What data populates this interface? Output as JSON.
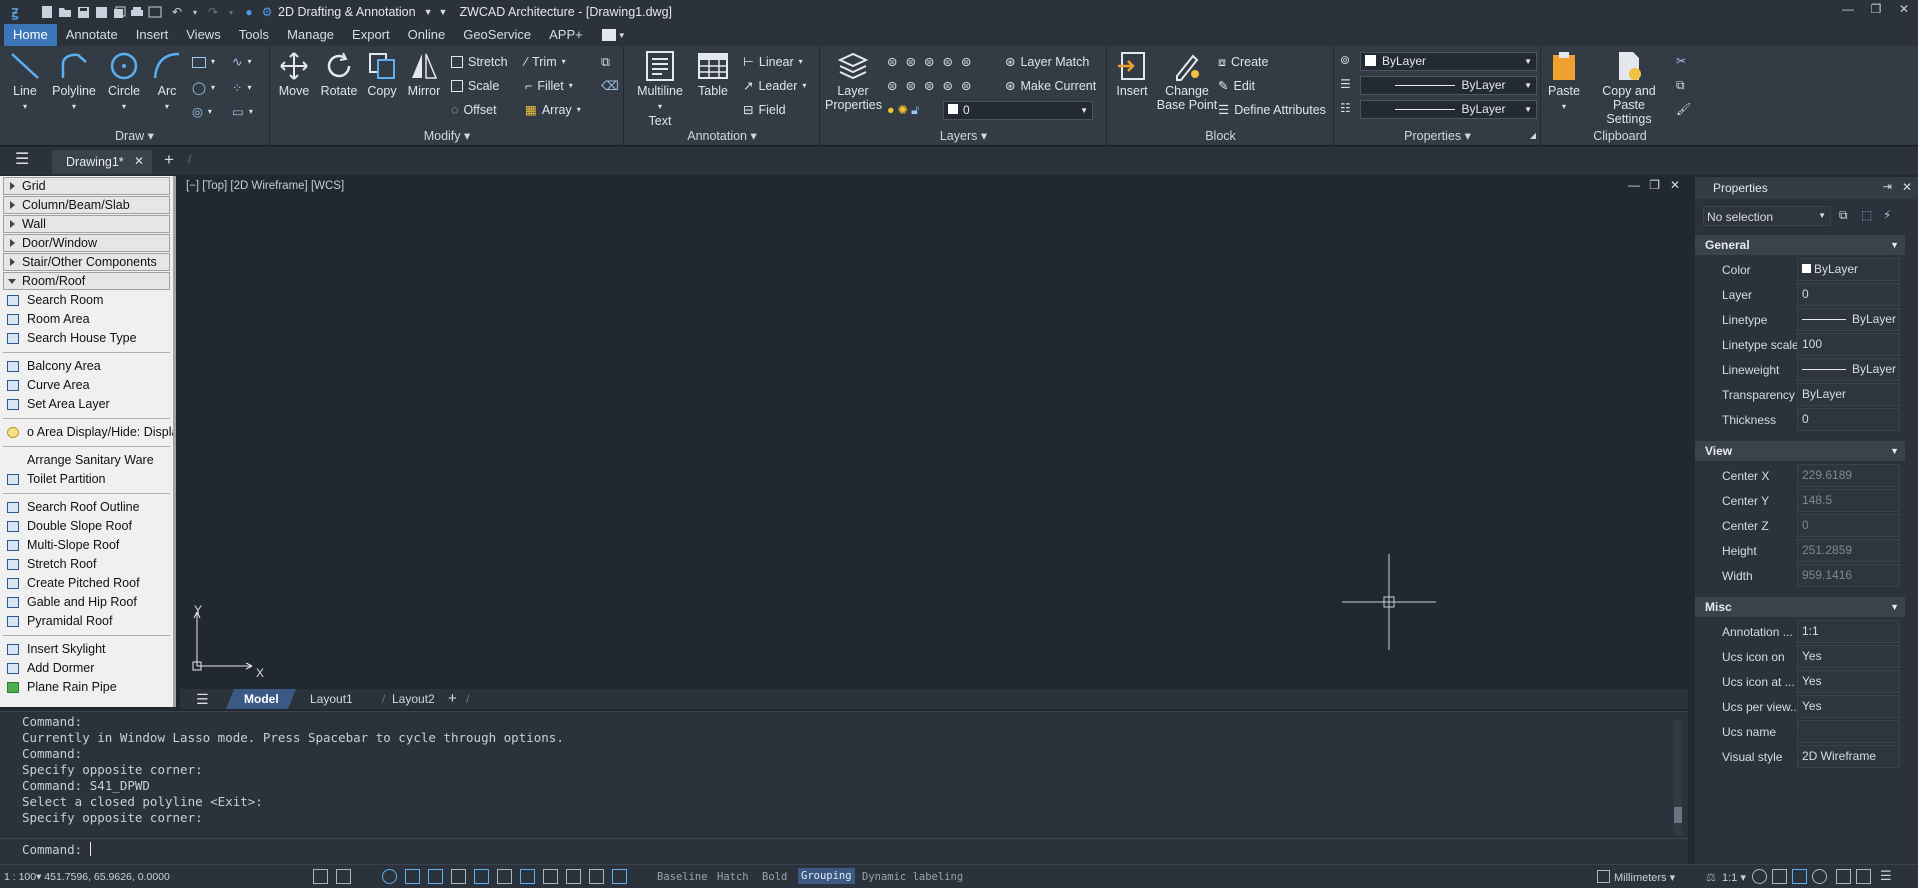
{
  "title_bar": {
    "workspace": "2D Drafting & Annotation",
    "title": "ZWCAD Architecture - [Drawing1.dwg]"
  },
  "menu": [
    "Home",
    "Annotate",
    "Insert",
    "Views",
    "Tools",
    "Manage",
    "Export",
    "Online",
    "GeoService",
    "APP+"
  ],
  "ribbon": {
    "draw": {
      "title": "Draw",
      "line": "Line",
      "polyline": "Polyline",
      "circle": "Circle",
      "arc": "Arc"
    },
    "modify": {
      "title": "Modify",
      "move": "Move",
      "rotate": "Rotate",
      "copy": "Copy",
      "mirror": "Mirror",
      "stretch": "Stretch",
      "scale": "Scale",
      "offset": "Offset",
      "trim": "Trim",
      "fillet": "Fillet",
      "array": "Array"
    },
    "annotation": {
      "title": "Annotation",
      "mtext1": "Multiline",
      "mtext2": "Text",
      "table": "Table",
      "linear": "Linear",
      "leader": "Leader",
      "field": "Field"
    },
    "layers": {
      "title": "Layers",
      "props1": "Layer",
      "props2": "Properties",
      "match": "Layer Match",
      "current": "Make Current",
      "layer_value": "0"
    },
    "block": {
      "title": "Block",
      "insert": "Insert",
      "change1": "Change",
      "change2": "Base Point",
      "create": "Create",
      "edit": "Edit",
      "define": "Define Attributes"
    },
    "properties": {
      "title": "Properties",
      "color": "ByLayer",
      "linetype": "ByLayer",
      "lineweight": "ByLayer"
    },
    "clipboard": {
      "title": "Clipboard",
      "paste": "Paste",
      "copypaste1": "Copy and Paste",
      "copypaste2": "Settings"
    }
  },
  "doc_tab": "Drawing1*",
  "palette": {
    "categories": [
      "Grid",
      "Column/Beam/Slab",
      "Wall",
      "Door/Window",
      "Stair/Other Components",
      "Room/Roof"
    ],
    "items_a": [
      "Search Room",
      "Room Area",
      "Search House Type"
    ],
    "items_b": [
      "Balcony Area",
      "Curve Area",
      "Set Area Layer"
    ],
    "items_c": [
      "o Area Display/Hide: Display"
    ],
    "items_d": [
      "Arrange Sanitary Ware",
      "Toilet Partition"
    ],
    "items_e": [
      "Search Roof Outline",
      "Double Slope Roof",
      "Multi-Slope Roof",
      "Stretch Roof",
      "Create Pitched Roof",
      "Gable and Hip Roof",
      "Pyramidal Roof"
    ],
    "items_f": [
      "Insert Skylight",
      "Add Dormer",
      "Plane Rain Pipe"
    ]
  },
  "viewport": {
    "label": "[−] [Top] [2D Wireframe] [WCS]",
    "axis_x": "X",
    "axis_y": "Y"
  },
  "layout_tabs": [
    "Model",
    "Layout1",
    "Layout2"
  ],
  "command": {
    "history": [
      "Command:",
      "Currently in Window Lasso mode. Press Spacebar to cycle through options.",
      "Command:",
      "Specify opposite corner:",
      "Command: S41_DPWD",
      "Select a closed polyline <Exit>:",
      "Specify opposite corner:"
    ],
    "prompt": "Command:"
  },
  "properties_panel": {
    "title": "Properties",
    "selection": "No selection",
    "general": {
      "title": "General",
      "rows": [
        [
          "Color",
          "ByLayer"
        ],
        [
          "Layer",
          "0"
        ],
        [
          "Linetype",
          "ByLayer"
        ],
        [
          "Linetype scale",
          "100"
        ],
        [
          "Lineweight",
          "ByLayer"
        ],
        [
          "Transparency",
          "ByLayer"
        ],
        [
          "Thickness",
          "0"
        ]
      ]
    },
    "view": {
      "title": "View",
      "rows": [
        [
          "Center X",
          "229.6189"
        ],
        [
          "Center Y",
          "148.5"
        ],
        [
          "Center Z",
          "0"
        ],
        [
          "Height",
          "251.2859"
        ],
        [
          "Width",
          "959.1416"
        ]
      ]
    },
    "misc": {
      "title": "Misc",
      "rows": [
        [
          "Annotation ...",
          "1:1"
        ],
        [
          "Ucs icon on",
          "Yes"
        ],
        [
          "Ucs icon at ...",
          "Yes"
        ],
        [
          "Ucs per view...",
          "Yes"
        ],
        [
          "Ucs name",
          ""
        ],
        [
          "Visual style",
          "2D Wireframe"
        ]
      ]
    }
  },
  "status": {
    "coords": "1 : 100▾  451.7596, 65.9626, 0.0000",
    "toggles": [
      "Baseline",
      "Hatch",
      "Bold",
      "Grouping",
      "Dynamic labeling"
    ],
    "units": "Millimeters",
    "scale": "1:1"
  },
  "colors": {
    "accent": "#3b76b8",
    "canvas": "#212830",
    "panel": "#333b45"
  }
}
